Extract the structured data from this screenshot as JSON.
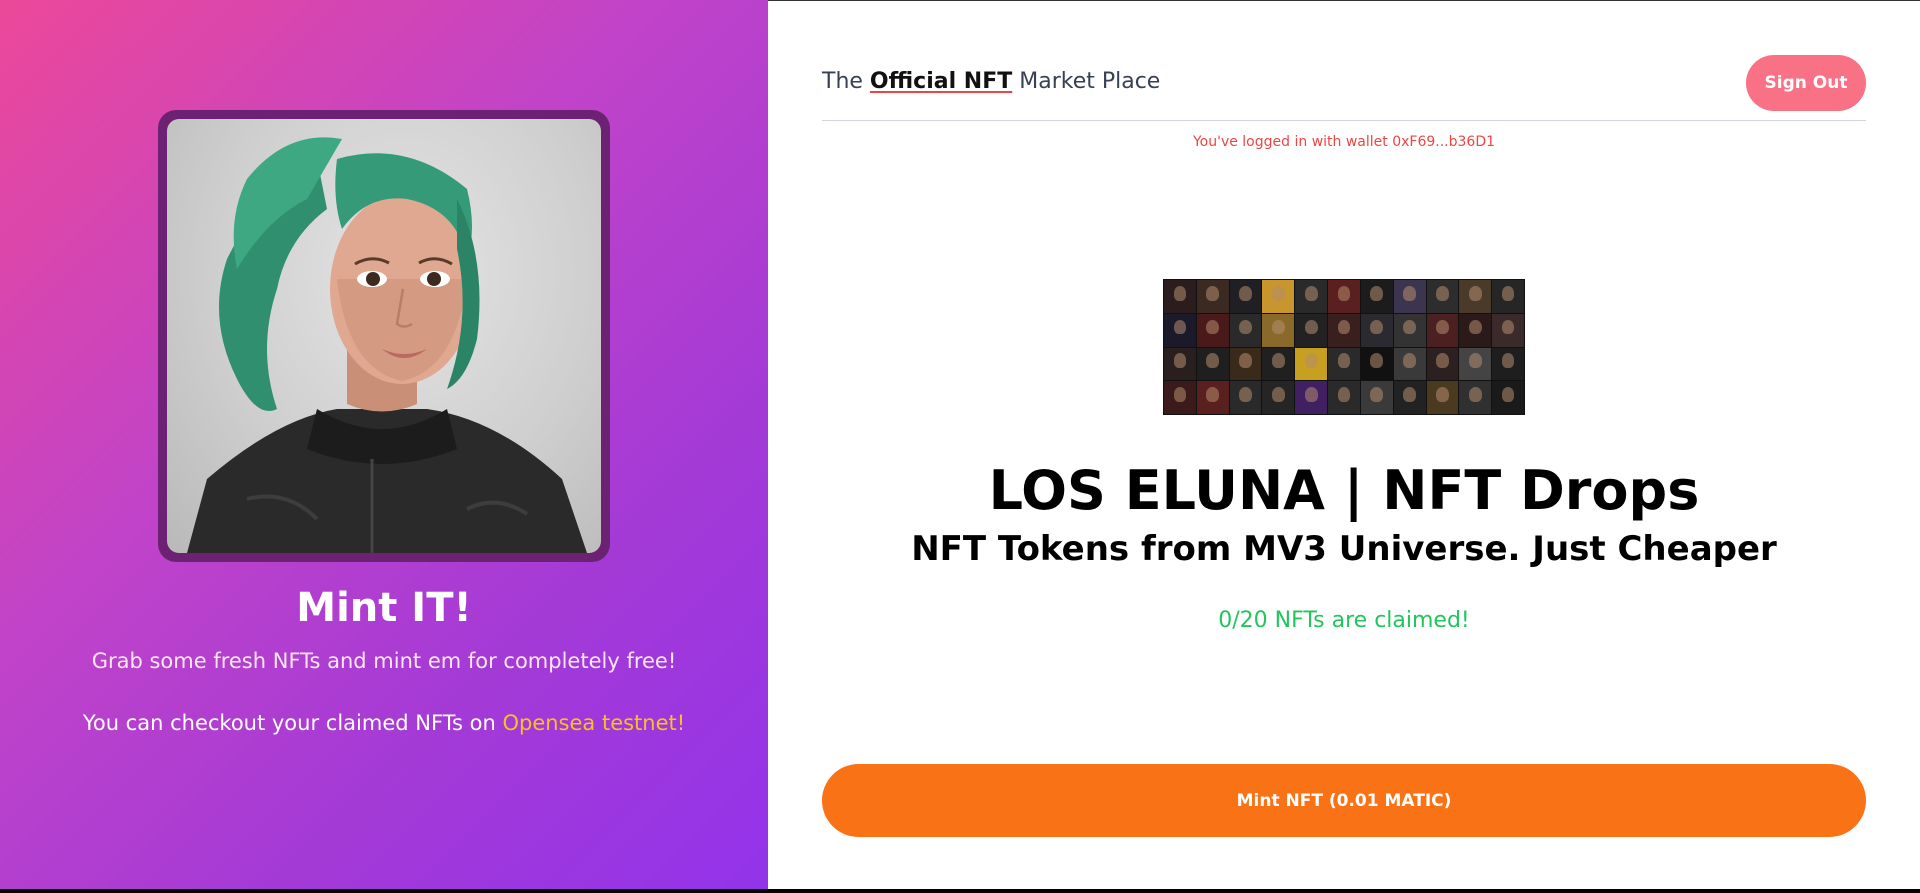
{
  "hero": {
    "title": "Mint IT!",
    "subtitle": "Grab some fresh NFTs and mint em for completely free!",
    "checkout_prefix": "You can checkout your claimed NFTs on ",
    "checkout_link": "Opensea testnet!"
  },
  "header": {
    "brand_prefix": "The ",
    "brand_bold": "Official NFT",
    "brand_suffix": " Market Place",
    "signout_label": "Sign Out"
  },
  "wallet_status": "You've logged in with wallet 0xF69...b36D1",
  "main": {
    "headline": "LOS ELUNA | NFT Drops",
    "subheadline": "NFT Tokens from MV3 Universe. Just Cheaper",
    "claimed_text": "0/20 NFTs are claimed!",
    "mint_button_label": "Mint NFT (0.01 MATIC)"
  },
  "colors": {
    "gradient_start": "#ec4899",
    "gradient_end": "#9333ea",
    "signout": "#f87185",
    "mint_button": "#f97316",
    "claimed": "#22c55e",
    "link": "#fbbf24",
    "wallet": "#ef4444"
  }
}
